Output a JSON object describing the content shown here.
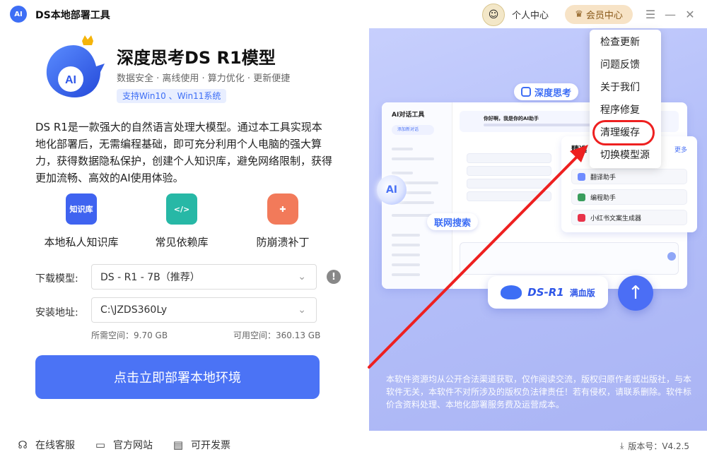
{
  "titlebar": {
    "app_title": "DS本地部署工具",
    "personal_center": "个人中心",
    "member_center": "会员中心",
    "menu_icon": "hamburger-icon",
    "minimize_icon": "minimize-icon",
    "close_icon": "close-icon"
  },
  "product": {
    "title": "深度思考DS R1模型",
    "tagline": "数据安全 · 离线使用 · 算力优化 · 更新便捷",
    "os_badge": "支持Win10 、Win11系统",
    "description": "DS R1是一款强大的自然语言处理大模型。通过本工具实现本地化部署后，无需编程基础，即可充分利用个人电脑的强大算力，获得数据隐私保护，创建个人知识库，避免网络限制，获得更加流畅、高效的AI使用体验。"
  },
  "features": [
    {
      "label": "本地私人知识库",
      "icon": "knowledge-base-icon",
      "icon_text": "知识库"
    },
    {
      "label": "常见依赖库",
      "icon": "code-library-icon",
      "icon_text": "</>"
    },
    {
      "label": "防崩溃补丁",
      "icon": "bandage-icon",
      "icon_text": ""
    }
  ],
  "form": {
    "model_label": "下载模型:",
    "model_value": "DS - R1 - 7B（推荐）",
    "path_label": "安装地址:",
    "path_value": "C:\\JZDS360Ly",
    "required_space": "所需空间：9.70 GB",
    "free_space": "可用空间：360.13 GB",
    "deploy_button": "点击立即部署本地环境"
  },
  "footer": {
    "support": "在线客服",
    "website": "官方网站",
    "invoice": "可开发票",
    "version": "版本号：V4.2.5"
  },
  "menu": {
    "items": [
      "检查更新",
      "问题反馈",
      "关于我们",
      "程序修复",
      "清理缓存",
      "切换模型源"
    ],
    "highlighted": "清理缓存"
  },
  "promo": {
    "deep_think": "深度思考",
    "net_search": "联网搜索",
    "mock_title": "AI对话工具",
    "mock_new_chat": "添加新对话",
    "mock_greeting": "你好啊，我是你的AI助手",
    "side_title": "精选",
    "side_more": "更多",
    "side_items": [
      "翻译助手",
      "编程助手",
      "小红书文案生成器"
    ],
    "r1_banner": "DS-R1",
    "r1_full": "满血版",
    "orb_text": "AI",
    "disclaimer": "本软件资源均从公开合法渠道获取，仅作阅读交流，版权归原作者或出版社，与本软件无关，本软件不对所涉及的版权负法律责任！若有侵权，请联系删除。软件标价含资料处理、本地化部署服务费及运营成本。"
  },
  "colors": {
    "accent": "#4b73f5",
    "highlight_ring": "#ee2020",
    "member_bg": "#f7e3c6"
  }
}
